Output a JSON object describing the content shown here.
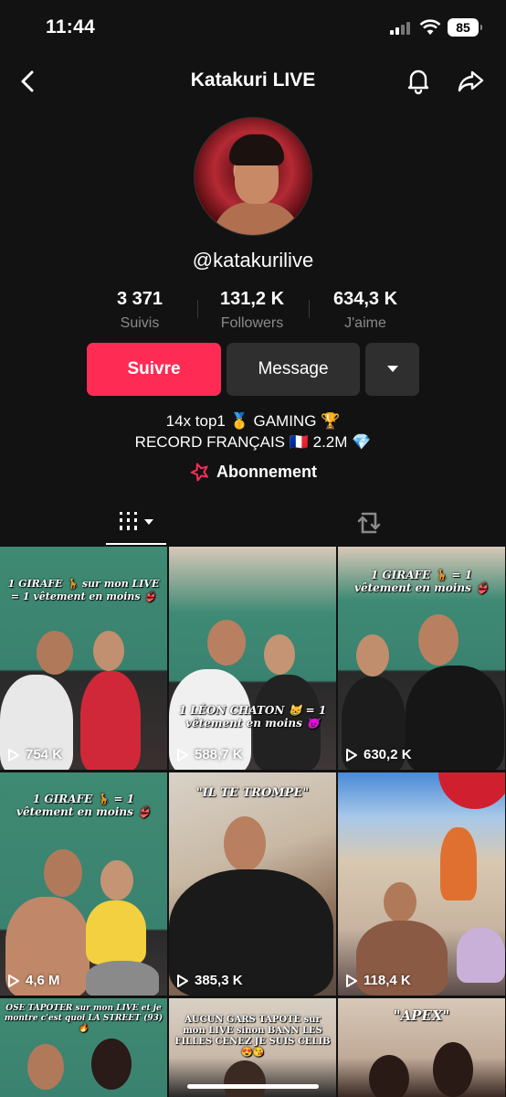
{
  "status_bar": {
    "time": "11:44",
    "battery": "85"
  },
  "nav": {
    "title": "Katakuri LIVE"
  },
  "profile": {
    "handle": "@katakurilive",
    "stats": [
      {
        "value": "3 371",
        "label": "Suivis"
      },
      {
        "value": "131,2 K",
        "label": "Followers"
      },
      {
        "value": "634,3 K",
        "label": "J'aime"
      }
    ],
    "follow_label": "Suivre",
    "message_label": "Message",
    "bio_line1": "14x top1 🥇 GAMING 🏆",
    "bio_line2": "RECORD FRANÇAIS 🇫🇷 2.2M 💎",
    "subscription_label": "Abonnement"
  },
  "colors": {
    "accent": "#fe2c55",
    "background": "#121212",
    "button_dark": "#2f2f2f"
  },
  "videos": [
    {
      "views": "754 K",
      "caption": "1 GIRAFE 🦒 sur mon LIVE = 1 vêtement en moins 👙"
    },
    {
      "views": "588,7 K",
      "caption": "1 LÉON CHATON 😸 = 1 vêtement en moins 😈"
    },
    {
      "views": "630,2 K",
      "caption": "1 GIRAFE 🦒 = 1 vêtement en moins 👙"
    },
    {
      "views": "4,6 M",
      "caption": "1 GIRAFE 🦒 = 1 vêtement en moins 👙"
    },
    {
      "views": "385,3 K",
      "caption": "\"IL TE TROMPE\""
    },
    {
      "views": "118,4 K",
      "caption": ""
    },
    {
      "views": "",
      "caption": "OSE TAPOTER sur mon LIVE et je montre c'est quoi LA STREET (93) 🔥"
    },
    {
      "views": "",
      "caption": "AUCUN GARS TAPOTE sur mon LIVE sinon BANN LES FILLES CENEZ JE SUIS CELIB 😍😘"
    },
    {
      "views": "",
      "caption": "\"APEX\""
    }
  ]
}
